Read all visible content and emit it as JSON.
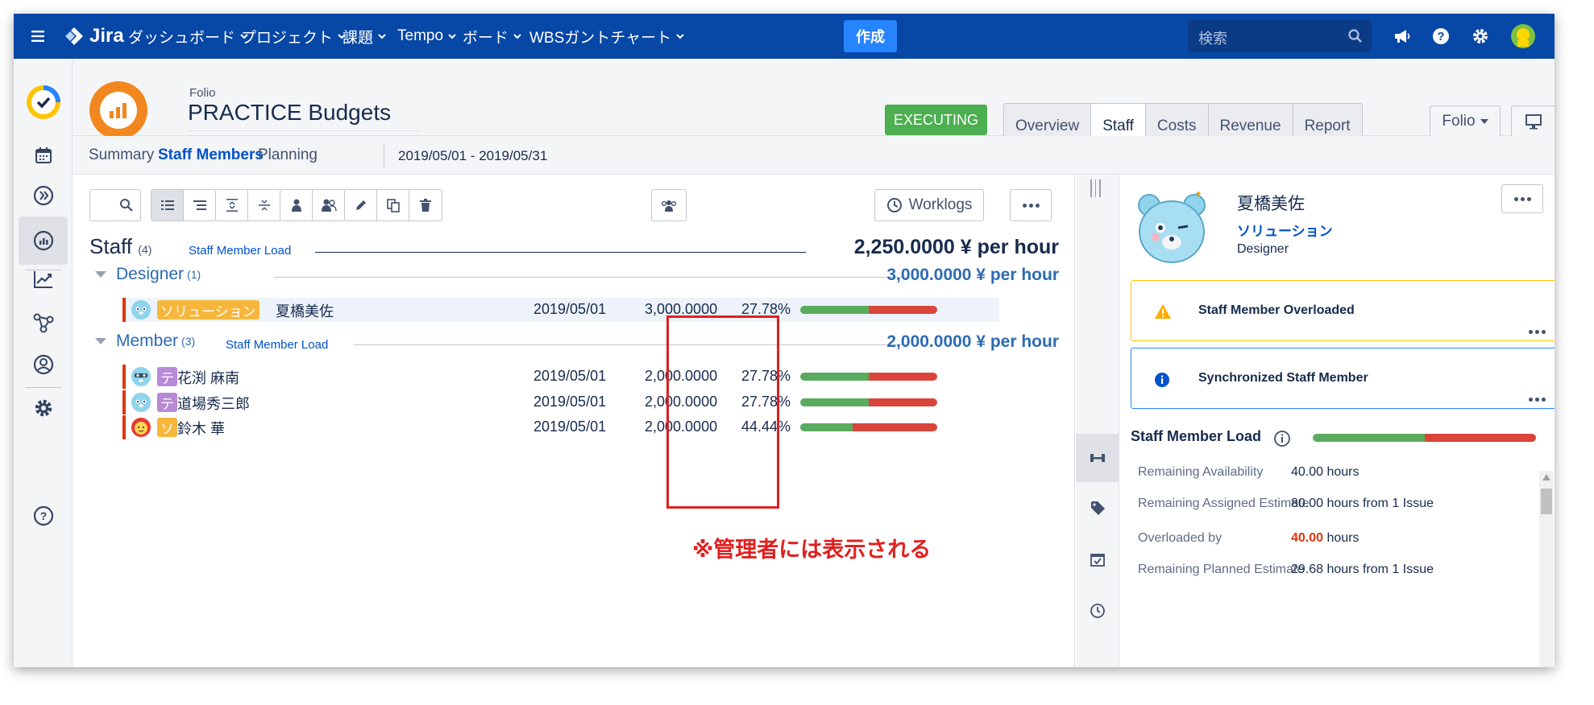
{
  "topbar": {
    "logo_text": "Jira",
    "nav": [
      "ダッシュボード",
      "プロジェクト",
      "課題",
      "Tempo",
      "ボード",
      "WBSガントチャート"
    ],
    "create_label": "作成",
    "search_placeholder": "検索"
  },
  "project": {
    "category": "Folio",
    "name": "PRACTICE Budgets",
    "status": "EXECUTING",
    "tabs": [
      "Overview",
      "Staff",
      "Costs",
      "Revenue",
      "Report"
    ],
    "active_tab": "Staff",
    "folio_menu": "Folio"
  },
  "subnav": {
    "tabs": [
      "Summary",
      "Staff Members",
      "Planning"
    ],
    "active": "Staff Members",
    "date_range": "2019/05/01  -  2019/05/31"
  },
  "toolbar": {
    "worklogs_label": "Worklogs"
  },
  "staff": {
    "title": "Staff",
    "count": "(4)",
    "load_link": "Staff Member Load",
    "rate": "2,250.0000 ¥ per hour",
    "groups": [
      {
        "name": "Designer",
        "count": "(1)",
        "rate": "3,000.0000 ¥ per hour",
        "members": [
          {
            "tag": "ソリューション",
            "tag_color": "#f6b73c",
            "name": "夏橋美佐",
            "date": "2019/05/01",
            "amount": "3,000.0000",
            "percent": "27.78%",
            "load_fraction": 0.5
          }
        ]
      },
      {
        "name": "Member",
        "count": "(3)",
        "load_link": "Staff Member Load",
        "rate": "2,000.0000 ¥ per hour",
        "members": [
          {
            "tag": "テ",
            "tag_color": "#b789d6",
            "name": "花渕 麻南",
            "date": "2019/05/01",
            "amount": "2,000.0000",
            "percent": "27.78%",
            "load_fraction": 0.5
          },
          {
            "tag": "テ",
            "tag_color": "#b789d6",
            "name": "道場秀三郎",
            "date": "2019/05/01",
            "amount": "2,000.0000",
            "percent": "27.78%",
            "load_fraction": 0.5
          },
          {
            "tag": "ソ",
            "tag_color": "#f6b73c",
            "name": "鈴木 華",
            "date": "2019/05/01",
            "amount": "2,000.0000",
            "percent": "44.44%",
            "load_fraction": 0.38
          }
        ]
      }
    ]
  },
  "admin_note": "※管理者には表示される",
  "detail": {
    "name": "夏橋美佐",
    "team": "ソリューション",
    "role": "Designer",
    "alerts": [
      "Staff Member Overloaded",
      "Synchronized Staff Member"
    ],
    "load_title": "Staff Member Load",
    "load_fraction": 0.5,
    "rows": [
      {
        "label": "Remaining Availability",
        "value": "40.00 hours"
      },
      {
        "label": "Remaining Assigned Estimate",
        "value": "80.00 hours from 1 Issue"
      },
      {
        "label": "Overloaded by",
        "value_highlight": "40.00",
        "value_rest": " hours"
      },
      {
        "label": "Remaining Planned Estimate",
        "value": "29.68 hours from 1 Issue"
      }
    ]
  },
  "colors": {
    "topbar": "#0747a6",
    "accent": "#0052cc",
    "executing": "#4caf50",
    "note_red": "#e02020"
  }
}
